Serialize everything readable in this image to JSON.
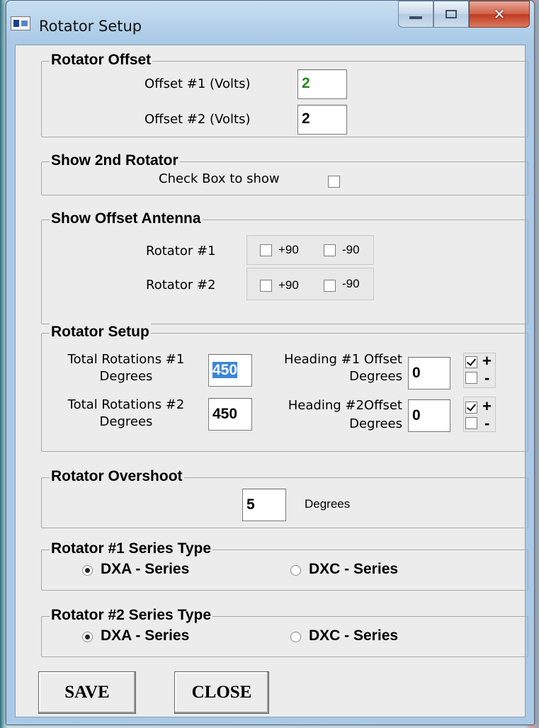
{
  "window": {
    "title": "Rotator Setup"
  },
  "rotator_offset": {
    "legend": "Rotator Offset",
    "offset1_label": "Offset #1 (Volts)",
    "offset1_value": "2",
    "offset2_label": "Offset #2 (Volts)",
    "offset2_value": "2"
  },
  "show_2nd_rotator": {
    "legend": "Show 2nd Rotator",
    "checkbox_label": "Check Box to show",
    "checked": false
  },
  "show_offset_antenna": {
    "legend": "Show Offset Antenna",
    "rotator1_label": "Rotator #1",
    "rotator2_label": "Rotator #2",
    "plus90": "+90",
    "minus90": "-90"
  },
  "rotator_setup": {
    "legend": "Rotator Setup",
    "total1_label_line1": "Total Rotations #1",
    "total1_label_line2": "Degrees",
    "total1_value": "450",
    "total2_label_line1": "Total Rotations #2",
    "total2_label_line2": "Degrees",
    "total2_value": "450",
    "heading1_label_line1": "Heading #1 Offset",
    "heading1_label_line2": "Degrees",
    "heading1_value": "0",
    "heading2_label_line1": "Heading #2Offset",
    "heading2_label_line2": "Degrees",
    "heading2_value": "0",
    "plus": "+",
    "minus": "-"
  },
  "rotator_overshoot": {
    "legend": "Rotator Overshoot",
    "value": "5",
    "unit": "Degrees"
  },
  "rotator1_series": {
    "legend": "Rotator #1 Series Type",
    "option_dxa": "DXA - Series",
    "option_dxc": "DXC - Series",
    "selected": "DXA - Series"
  },
  "rotator2_series": {
    "legend": "Rotator #2 Series Type",
    "option_dxa": "DXA - Series",
    "option_dxc": "DXC - Series",
    "selected": "DXA - Series"
  },
  "buttons": {
    "save": "SAVE",
    "close": "CLOSE"
  },
  "icons": {
    "app": "app-icon",
    "minimize": "minimize-icon",
    "maximize": "maximize-icon",
    "close": "close-icon"
  }
}
